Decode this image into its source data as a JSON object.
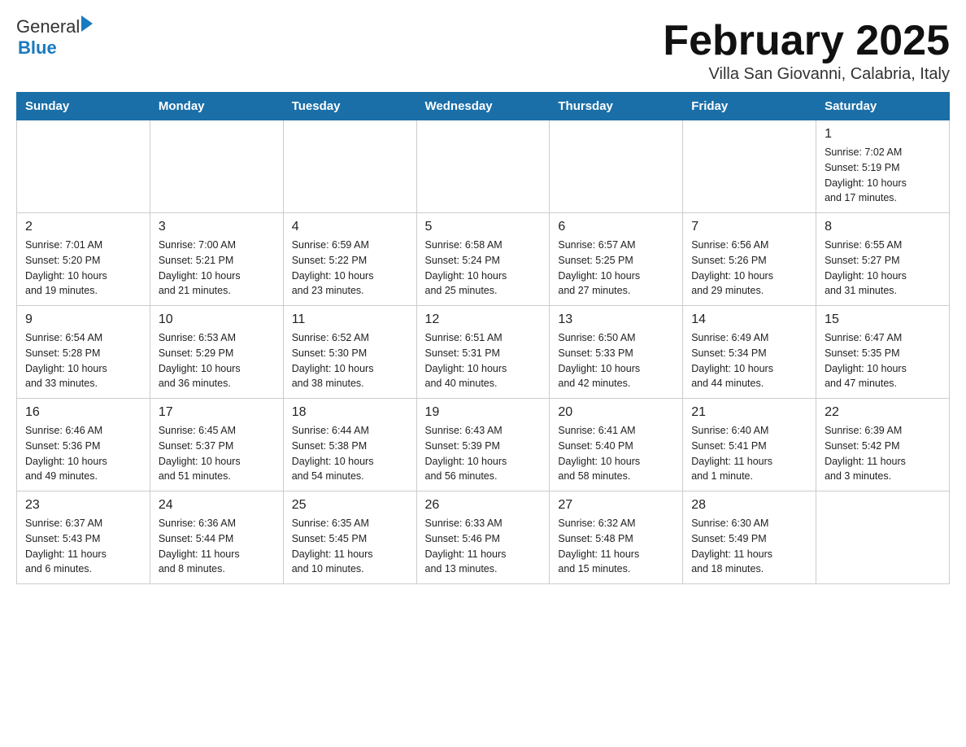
{
  "header": {
    "logo_general": "General",
    "logo_blue": "Blue",
    "title": "February 2025",
    "subtitle": "Villa San Giovanni, Calabria, Italy"
  },
  "weekdays": [
    "Sunday",
    "Monday",
    "Tuesday",
    "Wednesday",
    "Thursday",
    "Friday",
    "Saturday"
  ],
  "weeks": [
    [
      {
        "day": "",
        "info": ""
      },
      {
        "day": "",
        "info": ""
      },
      {
        "day": "",
        "info": ""
      },
      {
        "day": "",
        "info": ""
      },
      {
        "day": "",
        "info": ""
      },
      {
        "day": "",
        "info": ""
      },
      {
        "day": "1",
        "info": "Sunrise: 7:02 AM\nSunset: 5:19 PM\nDaylight: 10 hours\nand 17 minutes."
      }
    ],
    [
      {
        "day": "2",
        "info": "Sunrise: 7:01 AM\nSunset: 5:20 PM\nDaylight: 10 hours\nand 19 minutes."
      },
      {
        "day": "3",
        "info": "Sunrise: 7:00 AM\nSunset: 5:21 PM\nDaylight: 10 hours\nand 21 minutes."
      },
      {
        "day": "4",
        "info": "Sunrise: 6:59 AM\nSunset: 5:22 PM\nDaylight: 10 hours\nand 23 minutes."
      },
      {
        "day": "5",
        "info": "Sunrise: 6:58 AM\nSunset: 5:24 PM\nDaylight: 10 hours\nand 25 minutes."
      },
      {
        "day": "6",
        "info": "Sunrise: 6:57 AM\nSunset: 5:25 PM\nDaylight: 10 hours\nand 27 minutes."
      },
      {
        "day": "7",
        "info": "Sunrise: 6:56 AM\nSunset: 5:26 PM\nDaylight: 10 hours\nand 29 minutes."
      },
      {
        "day": "8",
        "info": "Sunrise: 6:55 AM\nSunset: 5:27 PM\nDaylight: 10 hours\nand 31 minutes."
      }
    ],
    [
      {
        "day": "9",
        "info": "Sunrise: 6:54 AM\nSunset: 5:28 PM\nDaylight: 10 hours\nand 33 minutes."
      },
      {
        "day": "10",
        "info": "Sunrise: 6:53 AM\nSunset: 5:29 PM\nDaylight: 10 hours\nand 36 minutes."
      },
      {
        "day": "11",
        "info": "Sunrise: 6:52 AM\nSunset: 5:30 PM\nDaylight: 10 hours\nand 38 minutes."
      },
      {
        "day": "12",
        "info": "Sunrise: 6:51 AM\nSunset: 5:31 PM\nDaylight: 10 hours\nand 40 minutes."
      },
      {
        "day": "13",
        "info": "Sunrise: 6:50 AM\nSunset: 5:33 PM\nDaylight: 10 hours\nand 42 minutes."
      },
      {
        "day": "14",
        "info": "Sunrise: 6:49 AM\nSunset: 5:34 PM\nDaylight: 10 hours\nand 44 minutes."
      },
      {
        "day": "15",
        "info": "Sunrise: 6:47 AM\nSunset: 5:35 PM\nDaylight: 10 hours\nand 47 minutes."
      }
    ],
    [
      {
        "day": "16",
        "info": "Sunrise: 6:46 AM\nSunset: 5:36 PM\nDaylight: 10 hours\nand 49 minutes."
      },
      {
        "day": "17",
        "info": "Sunrise: 6:45 AM\nSunset: 5:37 PM\nDaylight: 10 hours\nand 51 minutes."
      },
      {
        "day": "18",
        "info": "Sunrise: 6:44 AM\nSunset: 5:38 PM\nDaylight: 10 hours\nand 54 minutes."
      },
      {
        "day": "19",
        "info": "Sunrise: 6:43 AM\nSunset: 5:39 PM\nDaylight: 10 hours\nand 56 minutes."
      },
      {
        "day": "20",
        "info": "Sunrise: 6:41 AM\nSunset: 5:40 PM\nDaylight: 10 hours\nand 58 minutes."
      },
      {
        "day": "21",
        "info": "Sunrise: 6:40 AM\nSunset: 5:41 PM\nDaylight: 11 hours\nand 1 minute."
      },
      {
        "day": "22",
        "info": "Sunrise: 6:39 AM\nSunset: 5:42 PM\nDaylight: 11 hours\nand 3 minutes."
      }
    ],
    [
      {
        "day": "23",
        "info": "Sunrise: 6:37 AM\nSunset: 5:43 PM\nDaylight: 11 hours\nand 6 minutes."
      },
      {
        "day": "24",
        "info": "Sunrise: 6:36 AM\nSunset: 5:44 PM\nDaylight: 11 hours\nand 8 minutes."
      },
      {
        "day": "25",
        "info": "Sunrise: 6:35 AM\nSunset: 5:45 PM\nDaylight: 11 hours\nand 10 minutes."
      },
      {
        "day": "26",
        "info": "Sunrise: 6:33 AM\nSunset: 5:46 PM\nDaylight: 11 hours\nand 13 minutes."
      },
      {
        "day": "27",
        "info": "Sunrise: 6:32 AM\nSunset: 5:48 PM\nDaylight: 11 hours\nand 15 minutes."
      },
      {
        "day": "28",
        "info": "Sunrise: 6:30 AM\nSunset: 5:49 PM\nDaylight: 11 hours\nand 18 minutes."
      },
      {
        "day": "",
        "info": ""
      }
    ]
  ]
}
